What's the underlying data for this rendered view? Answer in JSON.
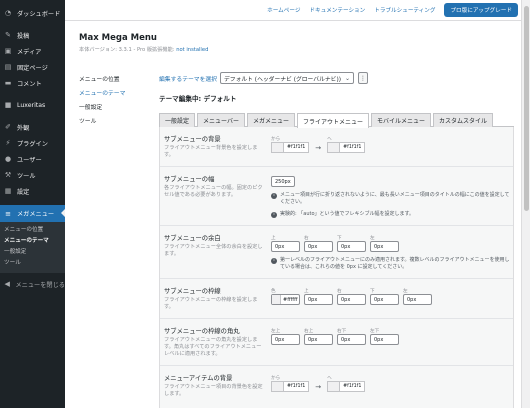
{
  "sidebar": {
    "items": [
      {
        "label": "ダッシュボード",
        "icon": "dashboard-icon"
      },
      {
        "label": "投稿",
        "icon": "pin-icon"
      },
      {
        "label": "メディア",
        "icon": "media-icon"
      },
      {
        "label": "固定ページ",
        "icon": "page-icon"
      },
      {
        "label": "コメント",
        "icon": "comment-icon"
      },
      {
        "label": "Luxeritas",
        "icon": "luxeritas-icon"
      },
      {
        "label": "外観",
        "icon": "brush-icon"
      },
      {
        "label": "プラグイン",
        "icon": "plugin-icon"
      },
      {
        "label": "ユーザー",
        "icon": "user-icon"
      },
      {
        "label": "ツール",
        "icon": "wrench-icon"
      },
      {
        "label": "設定",
        "icon": "settings-icon"
      }
    ],
    "current": {
      "label": "メガメニュー",
      "icon": "menu-icon"
    },
    "submenu": [
      "メニューの位置",
      "メニューのテーマ",
      "一般設定",
      "ツール"
    ],
    "collapse": "メニューを閉じる"
  },
  "toplinks": {
    "home": "ホームページ",
    "docs": "ドキュメンテーション",
    "trouble": "トラブルシューティング",
    "pro": "プロ版にアップグレード"
  },
  "plugin": {
    "title": "Max Mega Menu",
    "version": "本体バージョン: 3.3.1 - Pro 版拡張機能:",
    "version_status": "not installed"
  },
  "subnav": [
    "メニューの位置",
    "メニューのテーマ",
    "一般設定",
    "ツール"
  ],
  "theme_selector": {
    "label": "編集するテーマを選択",
    "value": "デフォルト (ヘッダーナビ (グローバルナビ))",
    "editing": "テーマ編集中: デフォルト"
  },
  "tabs": [
    "一般設定",
    "メニューバー",
    "メガメニュー",
    "フライアウトメニュー",
    "モバイルメニュー",
    "カスタムスタイル"
  ],
  "rows": {
    "bg": {
      "title": "サブメニューの背景",
      "desc": "フライアウトメニュー背景色を設定します。",
      "from_cap": "から",
      "from_val": "#f1f1f1",
      "to_cap": "へ",
      "to_val": "#f1f1f1",
      "arrow": "→"
    },
    "width": {
      "title": "サブメニューの幅",
      "desc": "各フライアウトメニューの幅。固定のピクセル値である必要があります。",
      "value": "250px",
      "note1": "メニュー項目が行に折り返されないように、最も長いメニュー項目のタイトルの幅にこの値を設定してください。",
      "note2": "実験的: 「auto」という値でフレキシブル幅を設定します。"
    },
    "padding": {
      "title": "サブメニューの余白",
      "desc": "フライアウトメニュー全体の余白を設定します。",
      "caps": [
        "上",
        "右",
        "下",
        "左"
      ],
      "values": [
        "0px",
        "0px",
        "0px",
        "0px"
      ],
      "note": "第一レベルのフライアウトメニューにのみ適用されます。複数レベルのフライアウトメニューを使用している場合は、これらの値を 0px に設定してください。"
    },
    "border": {
      "title": "サブメニューの枠線",
      "desc": "フライアウトメニューの枠線を設定します。",
      "caps": [
        "色",
        "上",
        "右",
        "下",
        "左"
      ],
      "values": [
        "#ffffff",
        "0px",
        "0px",
        "0px",
        "0px"
      ]
    },
    "radius": {
      "title": "サブメニューの枠線の角丸",
      "desc": "フライアウトメニューの角丸を設定します。角丸はすべてのフライアウトメニューレベルに適用されます。",
      "caps": [
        "左上",
        "右上",
        "右下",
        "左下"
      ],
      "values": [
        "0px",
        "0px",
        "0px",
        "0px"
      ]
    },
    "item_bg": {
      "title": "メニューアイテムの背景",
      "desc": "フライアウトメニュー項目の背景色を設定します。",
      "from_cap": "から",
      "from_val": "#f1f1f1",
      "to_cap": "へ",
      "to_val": "#f1f1f1",
      "arrow": "→"
    }
  },
  "colors": {
    "accent": "#2271b1",
    "sidebar_bg": "#1d2327",
    "submenu_bg": "#2c3338"
  }
}
